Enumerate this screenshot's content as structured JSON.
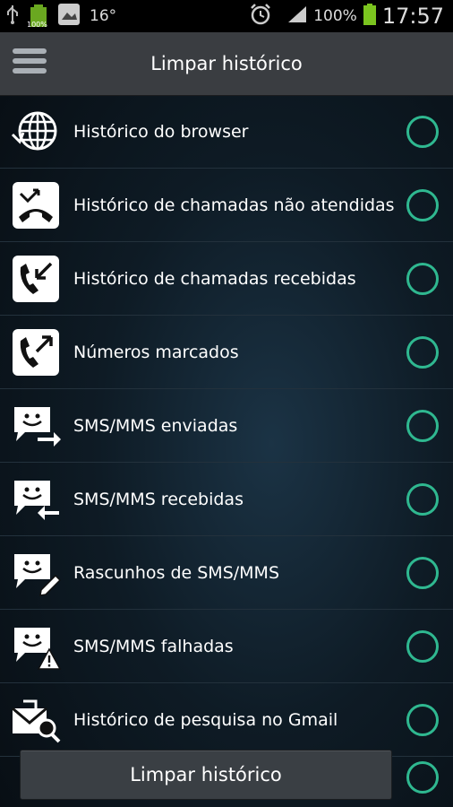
{
  "status_bar": {
    "left_text": "16°",
    "battery_small": "100%",
    "battery_pct": "100%",
    "time": "17:57"
  },
  "header": {
    "title": "Limpar histórico"
  },
  "items": [
    {
      "label": "Histórico do browser",
      "icon": "globe-icon"
    },
    {
      "label": "Histórico de chamadas não atendidas",
      "icon": "missed-call-icon"
    },
    {
      "label": "Histórico de chamadas recebidas",
      "icon": "incoming-call-icon"
    },
    {
      "label": "Números marcados",
      "icon": "outgoing-call-icon"
    },
    {
      "label": "SMS/MMS enviadas",
      "icon": "sms-sent-icon"
    },
    {
      "label": "SMS/MMS recebidas",
      "icon": "sms-received-icon"
    },
    {
      "label": "Rascunhos de SMS/MMS",
      "icon": "sms-draft-icon"
    },
    {
      "label": "SMS/MMS falhadas",
      "icon": "sms-failed-icon"
    },
    {
      "label": "Histórico de pesquisa no Gmail",
      "icon": "gmail-search-icon"
    }
  ],
  "bottom": {
    "button_label": "Limpar histórico"
  },
  "colors": {
    "accent": "#2fb890",
    "titlebar": "#3a3d41",
    "background": "#0e1b25"
  }
}
